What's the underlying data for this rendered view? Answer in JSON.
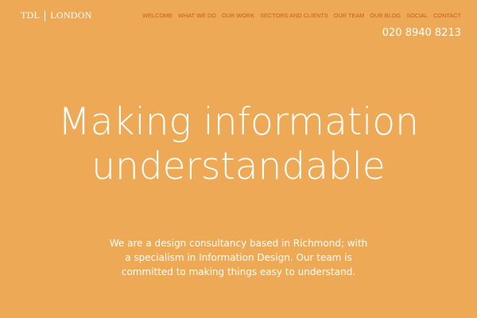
{
  "brand": {
    "left": "TDL",
    "right": "LONDON"
  },
  "nav": {
    "items": [
      "WELCOME",
      "WHAT WE DO",
      "OUR WORK",
      "SECTORS AND CLIENTS",
      "OUR TEAM",
      "OUR BLOG",
      "SOCIAL",
      "CONTACT"
    ]
  },
  "phone": "020 8940 8213",
  "hero": {
    "headline_lines": [
      "Making information",
      "understandable"
    ],
    "intro_lines": [
      "We are a design consultancy based in Richmond; with",
      "a specialism in Information Design. Our team is",
      "committed to making things easy to understand."
    ]
  },
  "colors": {
    "background": "#EDA955",
    "nav_text": "#C65E1C",
    "text": "#FFFFFF"
  }
}
